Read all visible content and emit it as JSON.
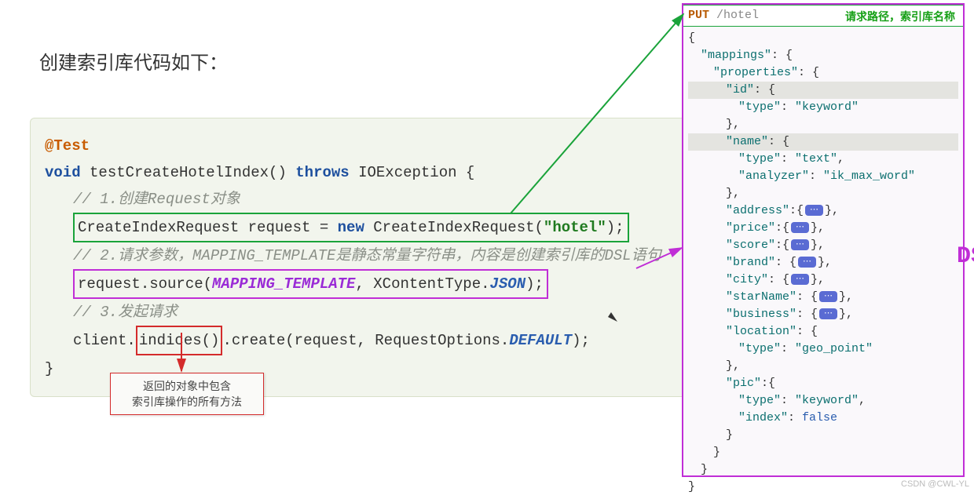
{
  "title": "创建索引库代码如下：",
  "code": {
    "annotation": "@Test",
    "sig_void": "void",
    "sig_name": " testCreateHotelIndex() ",
    "sig_throws": "throws",
    "sig_exc": " IOException {",
    "c1_comment": "// 1.创建Request对象",
    "c1_line_a": "CreateIndexRequest request = ",
    "c1_new": "new",
    "c1_line_b": " CreateIndexRequest(",
    "c1_str": "\"hotel\"",
    "c1_line_c": ");",
    "c2_comment_a": "// 2.请求参数，MAPPING_TEMPLATE是静态常量字符串，内容是创建索引库的",
    "c2_comment_b": "DSL",
    "c2_comment_c": "语句",
    "c2_line_a": "request.source(",
    "c2_tmpl": "MAPPING_TEMPLATE",
    "c2_line_b": ", XContentType.",
    "c2_json": "JSON",
    "c2_line_c": ");",
    "c3_comment": "// 3.发起请求",
    "c3_a": "client.",
    "c3_box": "indices()",
    "c3_b": ".create(request, RequestOptions.",
    "c3_def": "DEFAULT",
    "c3_c": ");",
    "close": "}"
  },
  "note": {
    "l1": "返回的对象中包含",
    "l2": "索引库操作的所有方法"
  },
  "dsl": {
    "method": "PUT",
    "path": "/hotel",
    "head_label": "请求路径，索引库名称",
    "big_label": "DSL",
    "lines": [
      {
        "ind": 0,
        "txt": "{"
      },
      {
        "ind": 1,
        "key": "\"mappings\"",
        "txt": ": {"
      },
      {
        "ind": 2,
        "key": "\"properties\"",
        "txt": ": {"
      },
      {
        "ind": 3,
        "key": "\"id\"",
        "txt": ": {",
        "hl": true
      },
      {
        "ind": 4,
        "key": "\"type\"",
        "txt": ": ",
        "str": "\"keyword\""
      },
      {
        "ind": 3,
        "txt": "},"
      },
      {
        "ind": 3,
        "key": "\"name\"",
        "txt": ": {",
        "hl": true
      },
      {
        "ind": 4,
        "key": "\"type\"",
        "txt": ": ",
        "str": "\"text\"",
        "tail": ","
      },
      {
        "ind": 4,
        "key": "\"analyzer\"",
        "txt": ": ",
        "str": "\"ik_max_word\""
      },
      {
        "ind": 3,
        "txt": "},"
      },
      {
        "ind": 3,
        "key": "\"address\"",
        "txt": ":{",
        "fold": true,
        "tail": "},"
      },
      {
        "ind": 3,
        "key": "\"price\"",
        "txt": ":{",
        "fold": true,
        "tail": "},"
      },
      {
        "ind": 3,
        "key": "\"score\"",
        "txt": ":{",
        "fold": true,
        "tail": "},"
      },
      {
        "ind": 3,
        "key": "\"brand\"",
        "txt": ": {",
        "fold": true,
        "tail": "},"
      },
      {
        "ind": 3,
        "key": "\"city\"",
        "txt": ": {",
        "fold": true,
        "tail": "},"
      },
      {
        "ind": 3,
        "key": "\"starName\"",
        "txt": ": {",
        "fold": true,
        "tail": "},"
      },
      {
        "ind": 3,
        "key": "\"business\"",
        "txt": ": {",
        "fold": true,
        "tail": "},"
      },
      {
        "ind": 3,
        "key": "\"location\"",
        "txt": ": {"
      },
      {
        "ind": 4,
        "key": "\"type\"",
        "txt": ": ",
        "str": "\"geo_point\""
      },
      {
        "ind": 3,
        "txt": "},"
      },
      {
        "ind": 3,
        "key": "\"pic\"",
        "txt": ":{"
      },
      {
        "ind": 4,
        "key": "\"type\"",
        "txt": ": ",
        "str": "\"keyword\"",
        "tail": ","
      },
      {
        "ind": 4,
        "key": "\"index\"",
        "txt": ": ",
        "lit": "false"
      },
      {
        "ind": 3,
        "txt": "}"
      },
      {
        "ind": 2,
        "txt": "}"
      },
      {
        "ind": 1,
        "txt": "}"
      },
      {
        "ind": 0,
        "txt": "}"
      }
    ]
  },
  "watermark": "CSDN @CWL-YL"
}
